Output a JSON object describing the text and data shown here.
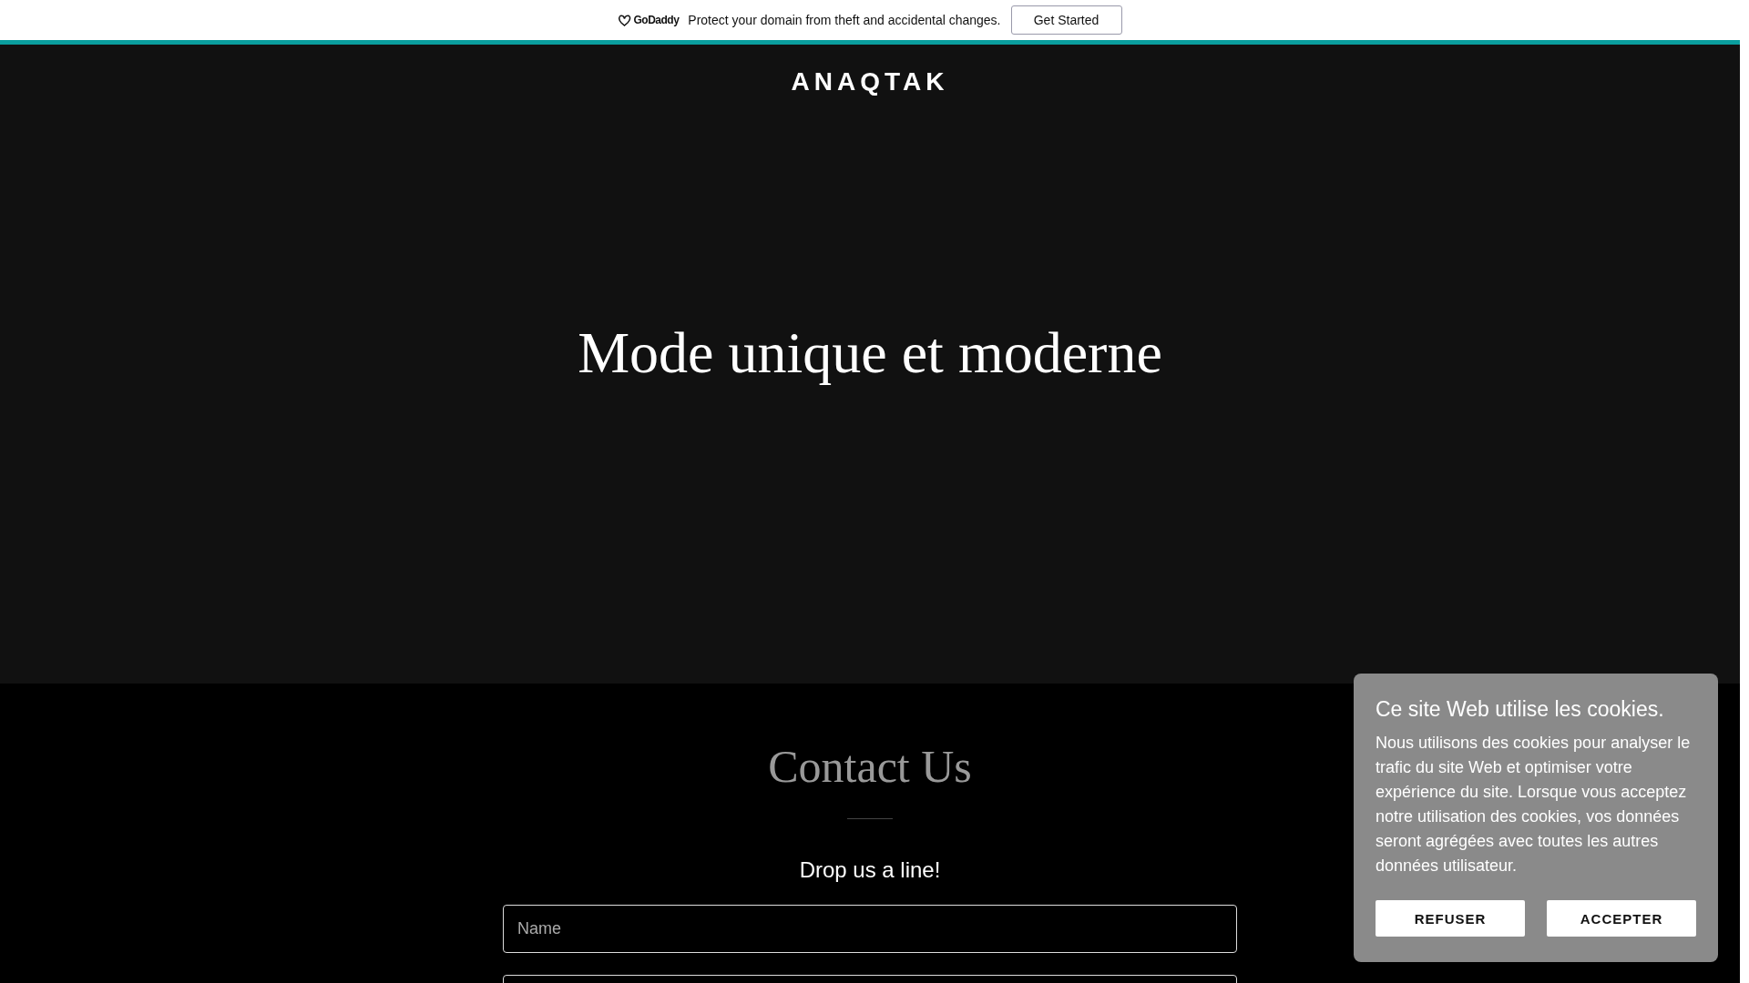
{
  "promo_bar": {
    "brand": "GoDaddy",
    "message": "Protect your domain from theft and accidental changes.",
    "button": "Get Started"
  },
  "header": {
    "site_title": "ANAQTAK"
  },
  "hero": {
    "headline": "Mode unique et moderne"
  },
  "contact": {
    "title": "Contact Us",
    "subtitle": "Drop us a line!",
    "fields": [
      {
        "placeholder": "Name"
      }
    ]
  },
  "cookie_banner": {
    "title": "Ce site Web utilise les cookies.",
    "message": "Nous utilisons des cookies pour analyser le trafic du site Web et optimiser votre expérience du site. Lorsque vous acceptez notre utilisation des cookies, vos données seront agrégées avec toutes les autres données utilisateur.",
    "buttons": [
      "REFUSER",
      "ACCEPTER"
    ]
  }
}
